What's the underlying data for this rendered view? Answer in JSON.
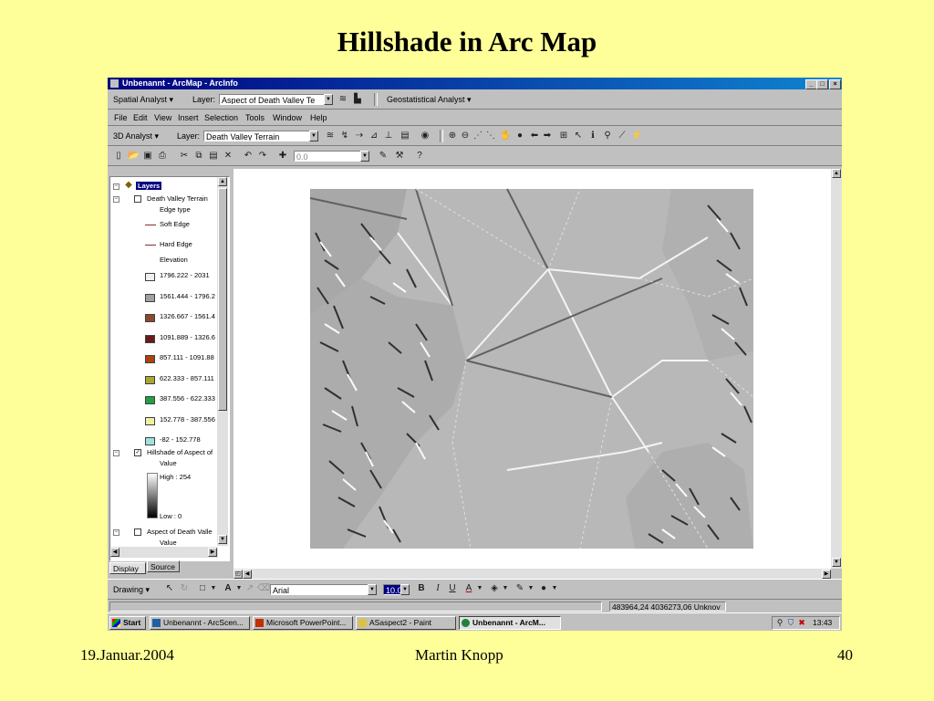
{
  "slide": {
    "title": "Hillshade in Arc Map",
    "footer_left": "19.Januar.2004",
    "footer_center": "Martin Knopp",
    "footer_right": "40"
  },
  "window": {
    "title": "Unbenannt - ArcMap - ArcInfo"
  },
  "spatial_toolbar": {
    "spatial_analyst": "Spatial Analyst ▾",
    "layer_label": "Layer:",
    "layer_value": "Aspect of Death Valley Te",
    "geostat": "Geostatistical Analyst ▾"
  },
  "menu": [
    "File",
    "Edit",
    "View",
    "Insert",
    "Selection",
    "Tools",
    "Window",
    "Help"
  ],
  "analyst3d_toolbar": {
    "label": "3D Analyst ▾",
    "layer_label": "Layer:",
    "layer_value": "Death Valley Terrain"
  },
  "standard_toolbar": {
    "scale_value": "0.0"
  },
  "toc": {
    "root": "Layers",
    "layer1": "Death Valley Terrain",
    "edge_type": "Edge type",
    "soft_edge": "Soft Edge",
    "hard_edge": "Hard Edge",
    "elevation": "Elevation",
    "classes": [
      {
        "label": "1796.222 - 2031",
        "color": "#f0f0f0"
      },
      {
        "label": "1561.444 - 1796.2",
        "color": "#a0a0a0"
      },
      {
        "label": "1326.667 - 1561.4",
        "color": "#8b4a2b"
      },
      {
        "label": "1091.889 - 1326.6",
        "color": "#6a1a1a"
      },
      {
        "label": "857.111 - 1091.88",
        "color": "#b04010"
      },
      {
        "label": "622.333 - 857.111",
        "color": "#a8a830"
      },
      {
        "label": "387.556 - 622.333",
        "color": "#20a040"
      },
      {
        "label": "152.778 - 387.556",
        "color": "#f0f0a0"
      },
      {
        "label": "-82 - 152.778",
        "color": "#a0e0e0"
      }
    ],
    "layer2": "Hillshade of Aspect of",
    "layer2_value": "Value",
    "high": "High : 254",
    "low": "Low : 0",
    "layer3": "Aspect of Death Valle",
    "layer3_value": "Value"
  },
  "tabs": {
    "display": "Display",
    "source": "Source"
  },
  "draw_toolbar": {
    "drawing": "Drawing ▾",
    "font": "Arial",
    "size": "10.0"
  },
  "status": {
    "coords": "483964,24  4036273,06 Unknov"
  },
  "taskbar": {
    "start": "Start",
    "tasks": [
      "Unbenannt - ArcScen...",
      "Microsoft PowerPoint...",
      "ASaspect2 - Paint",
      "Unbenannt - ArcM..."
    ],
    "clock": "13:43"
  },
  "colors": {
    "slide_bg": "#ffff99",
    "titlebar": "#000080",
    "hillshade_bg": "#b8b8b8"
  },
  "icons": [
    "arcmap-icon",
    "minimize-icon",
    "maximize-icon",
    "close-icon",
    "zoom-in-icon",
    "zoom-out-icon",
    "pan-icon",
    "identify-icon",
    "find-icon",
    "new-icon",
    "open-icon",
    "save-icon",
    "print-icon"
  ]
}
